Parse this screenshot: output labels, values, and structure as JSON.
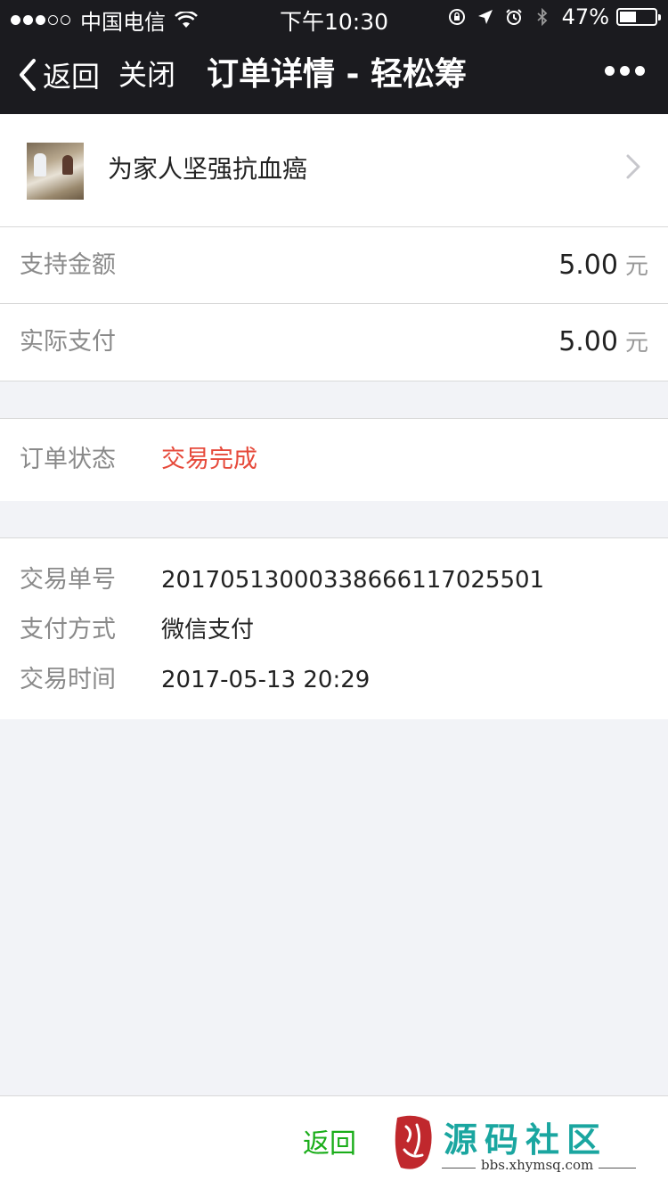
{
  "status_bar": {
    "carrier": "中国电信",
    "time": "下午10:30",
    "battery_percent_text": "47%",
    "battery_level": 0.47
  },
  "nav": {
    "back_label": "返回",
    "close_label": "关闭",
    "title": "订单详情 - 轻松筹"
  },
  "project": {
    "name": "为家人坚强抗血癌"
  },
  "amounts": {
    "support_label": "支持金额",
    "support_value": "5.00",
    "paid_label": "实际支付",
    "paid_value": "5.00",
    "unit": "元"
  },
  "order": {
    "status_label": "订单状态",
    "status_value": "交易完成",
    "status_color": "#e64a3b"
  },
  "details": {
    "trade_no_label": "交易单号",
    "trade_no_value": "2017051300033866611702550​1",
    "pay_method_label": "支付方式",
    "pay_method_value": "微信支付",
    "trade_time_label": "交易时间",
    "trade_time_value": "2017-05-13 20:29"
  },
  "bottom": {
    "back_label": "返回",
    "accent_color": "#1aad19"
  },
  "watermark": {
    "title": "源码社区",
    "url": "bbs.xhymsq.com"
  }
}
